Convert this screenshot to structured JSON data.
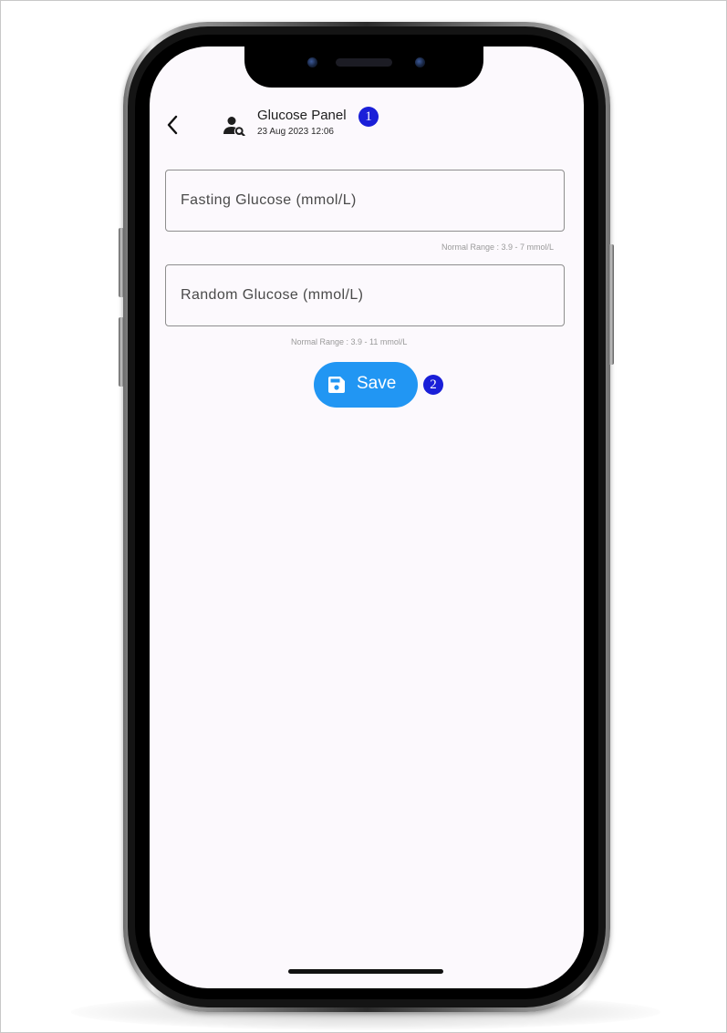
{
  "header": {
    "title": "Glucose Panel",
    "datetime": "23 Aug 2023 12:06",
    "title_marker": "1"
  },
  "form": {
    "fasting": {
      "placeholder": "Fasting Glucose (mmol/L)",
      "value": "",
      "helper": "Normal Range : 3.9 - 7 mmol/L"
    },
    "random": {
      "placeholder": "Random Glucose (mmol/L)",
      "value": "",
      "helper": "Normal Range : 3.9 - 11 mmol/L"
    }
  },
  "actions": {
    "save_label": "Save",
    "save_marker": "2"
  },
  "icons": {
    "back": "chevron-left-icon",
    "profile": "person-search-icon",
    "save": "floppy-disk-icon"
  },
  "colors": {
    "primary": "#2196f3",
    "marker": "#1a1fd8",
    "screen_background": "#fcf9fd"
  }
}
